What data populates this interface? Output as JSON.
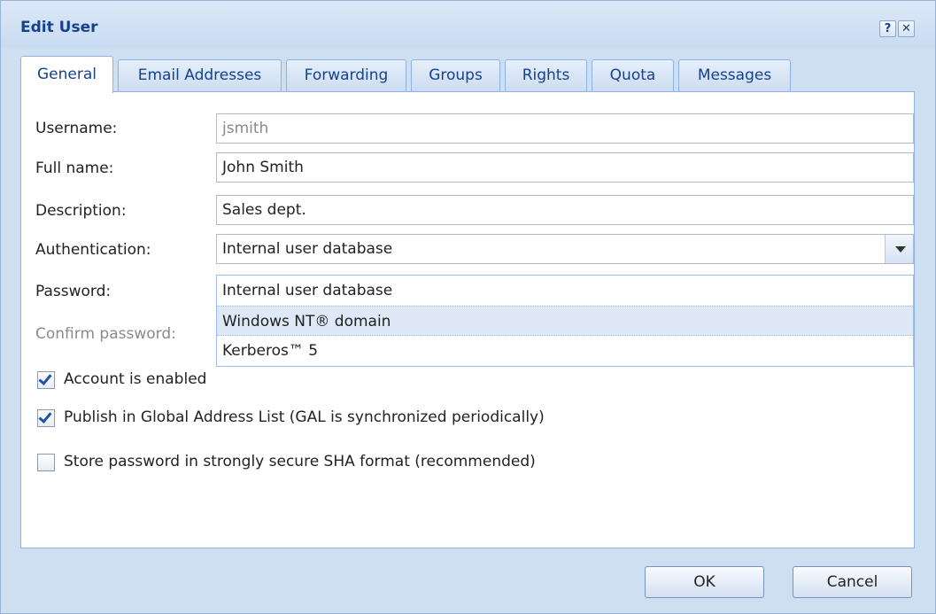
{
  "window": {
    "title": "Edit User",
    "help_glyph": "?",
    "close_glyph": "✕"
  },
  "tabs": [
    {
      "label": "General",
      "active": true
    },
    {
      "label": "Email Addresses",
      "active": false
    },
    {
      "label": "Forwarding",
      "active": false
    },
    {
      "label": "Groups",
      "active": false
    },
    {
      "label": "Rights",
      "active": false
    },
    {
      "label": "Quota",
      "active": false
    },
    {
      "label": "Messages",
      "active": false
    }
  ],
  "form": {
    "username_label": "Username:",
    "username_value": "jsmith",
    "fullname_label": "Full name:",
    "fullname_value": "John Smith",
    "description_label": "Description:",
    "description_value": "Sales dept.",
    "auth_label": "Authentication:",
    "auth_value": "Internal user database",
    "password_label": "Password:",
    "confirm_label": "Confirm password:"
  },
  "auth_options": [
    {
      "label": "Internal user database",
      "highlighted": false
    },
    {
      "label": "Windows NT® domain",
      "highlighted": true
    },
    {
      "label": "Kerberos™ 5",
      "highlighted": false
    }
  ],
  "checkboxes": [
    {
      "label": "Account is enabled",
      "checked": true
    },
    {
      "label": "Publish in Global Address List (GAL is synchronized periodically)",
      "checked": true
    },
    {
      "label": "Store password in strongly secure SHA format (recommended)",
      "checked": false
    }
  ],
  "buttons": {
    "ok": "OK",
    "cancel": "Cancel"
  },
  "colors": {
    "title_text": "#15428b",
    "frame": "#cfdff2",
    "tick": "#2152a8",
    "highlight": "#dfe8f6"
  }
}
